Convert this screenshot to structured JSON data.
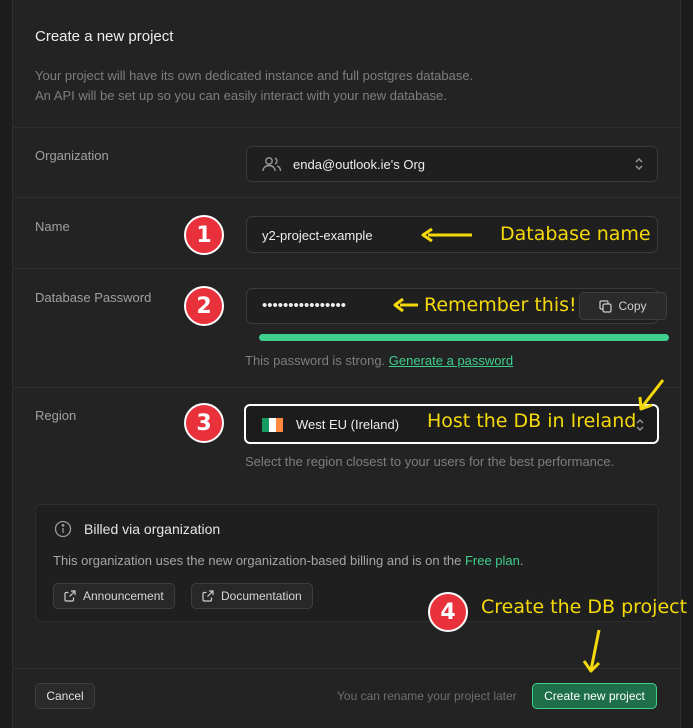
{
  "header": {
    "title": "Create a new project",
    "description_line1": "Your project will have its own dedicated instance and full postgres database.",
    "description_line2": "An API will be set up so you can easily interact with your new database."
  },
  "organization": {
    "label": "Organization",
    "value": "enda@outlook.ie's Org",
    "icon": "users-icon"
  },
  "name": {
    "label": "Name",
    "value": "y2-project-example"
  },
  "password": {
    "label": "Database Password",
    "value": "••••••••••••••••",
    "copy_label": "Copy",
    "strength_fraction": 1.0,
    "strength_color": "#3ecf8e",
    "hint_text": "This password is strong.",
    "generate_link": "Generate a password"
  },
  "region": {
    "label": "Region",
    "value": "West EU (Ireland)",
    "hint": "Select the region closest to your users for the best performance."
  },
  "billing": {
    "title": "Billed via organization",
    "text": "This organization uses the new organization-based billing and is on the",
    "plan_link": "Free plan",
    "suffix": ".",
    "buttons": [
      "Announcement",
      "Documentation"
    ]
  },
  "footer": {
    "cancel_label": "Cancel",
    "rename_hint": "You can rename your project later",
    "create_label": "Create new project"
  },
  "annotations": {
    "steps": [
      "1",
      "2",
      "3",
      "4"
    ],
    "database_name": "Database name",
    "remember_this": "Remember this!",
    "host_ireland": "Host the DB in Ireland",
    "create_project": "Create the DB project",
    "badge_color": "#e8313b",
    "text_color": "#f5d90a"
  },
  "colors": {
    "accent": "#3ecf8e",
    "background": "#1c1c1c",
    "panel": "#232323"
  }
}
